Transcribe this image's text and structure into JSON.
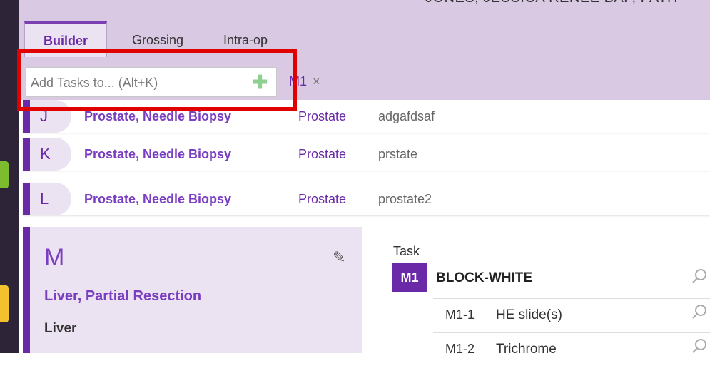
{
  "header": {
    "patient": "JONES, JESSICA RENEE    BAP, PATH"
  },
  "tabs": [
    {
      "label": "Builder",
      "active": true
    },
    {
      "label": "Grossing",
      "active": false
    },
    {
      "label": "Intra-op",
      "active": false
    }
  ],
  "add_tasks": {
    "placeholder": "Add Tasks to... (Alt+K)",
    "plus_icon": "plus-icon"
  },
  "chip": {
    "label": "M1",
    "close": "×"
  },
  "specimens": [
    {
      "letter": "J",
      "name": "Prostate, Needle Biopsy",
      "organ": "Prostate",
      "desc": "adgafdsaf"
    },
    {
      "letter": "K",
      "name": "Prostate, Needle Biopsy",
      "organ": "Prostate",
      "desc": "prstate"
    },
    {
      "letter": "L",
      "name": "Prostate, Needle Biopsy",
      "organ": "Prostate",
      "desc": "prostate2"
    }
  ],
  "selected_specimen": {
    "letter": "M",
    "name": "Liver, Partial Resection",
    "organ": "Liver"
  },
  "tasks": {
    "header": "Task",
    "main": {
      "id": "M1",
      "name": "BLOCK-WHITE"
    },
    "sub": [
      {
        "id": "M1-1",
        "name": "HE slide(s)"
      },
      {
        "id": "M1-2",
        "name": "Trichrome"
      }
    ]
  },
  "colors": {
    "accent": "#6a2aa8",
    "header_bg": "#d9c9e3",
    "highlight": "#e00000",
    "plus": "#8fcf8f"
  }
}
